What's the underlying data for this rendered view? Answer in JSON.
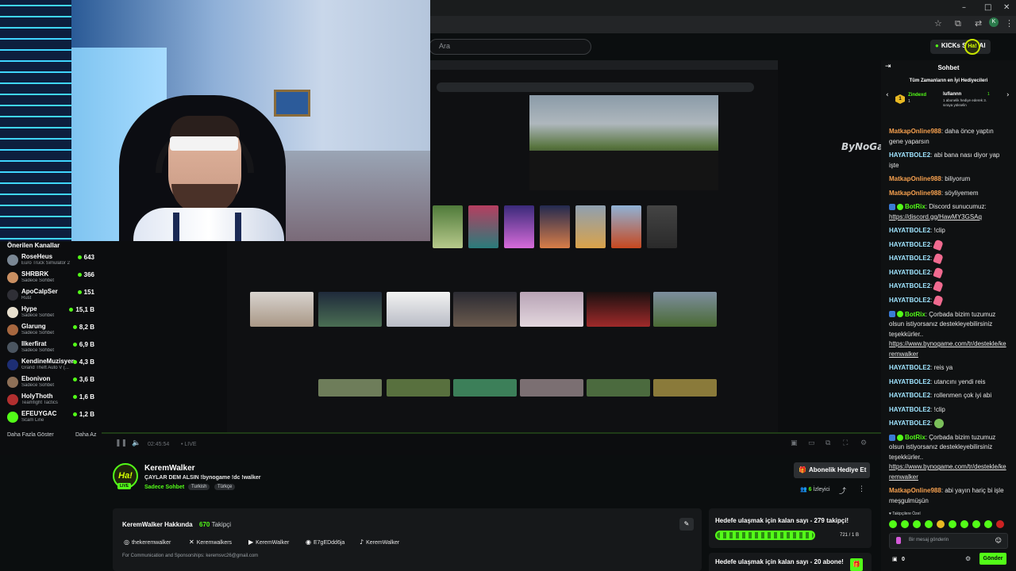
{
  "browser": {
    "window_controls": [
      "–",
      "□",
      "✕"
    ],
    "profile_initial": "K"
  },
  "header": {
    "search_placeholder": "Ara",
    "kicks_label": "KICKs Satın Al",
    "avatar_text": "Ha!"
  },
  "screen": {
    "watermark": "ByNoGame"
  },
  "sidebar": {
    "title": "Önerilen Kanallar",
    "items": [
      {
        "name": "RoseHeus",
        "category": "Euro Truck Simulator 2",
        "viewers": "643",
        "color": "#7a8794"
      },
      {
        "name": "SHRBRK",
        "category": "Sadece Sohbet",
        "viewers": "366",
        "color": "#c98f62"
      },
      {
        "name": "ApoCalpSer",
        "category": "Rust",
        "viewers": "151",
        "color": "#2f2f36"
      },
      {
        "name": "Hype",
        "category": "Sadece Sohbet",
        "viewers": "15,1 B",
        "color": "#e8e0cf"
      },
      {
        "name": "Glarung",
        "category": "Sadece Sohbet",
        "viewers": "8,2 B",
        "color": "#a7673f"
      },
      {
        "name": "Ilkerfirat",
        "category": "Sadece Sohbet",
        "viewers": "6,9 B",
        "color": "#4b5560"
      },
      {
        "name": "KendineMuzisyen",
        "category": "Grand Theft Auto V (...",
        "viewers": "4,3 B",
        "color": "#1d2e74"
      },
      {
        "name": "Ebonivon",
        "category": "Sadece Sohbet",
        "viewers": "3,6 B",
        "color": "#8e7057"
      },
      {
        "name": "HolyThoth",
        "category": "Teamfight Tactics",
        "viewers": "1,6 B",
        "color": "#b22f2f"
      },
      {
        "name": "EFEUYGAC",
        "category": "Scam Line",
        "viewers": "1,2 B",
        "color": "#53fc18"
      }
    ],
    "show_more": "Daha Fazla Göster",
    "show_less": "Daha Az"
  },
  "player": {
    "time": "02:45:54",
    "live": "• LIVE"
  },
  "channel": {
    "logo_text": "Ha!",
    "live_badge": "LIVE",
    "name": "KeremWalker",
    "title": "ÇAYLAR DEM ALSIN   !bynogame !dc !walker",
    "category": "Sadece Sohbet",
    "tags": [
      "Turkish",
      "Türkçe"
    ],
    "gift_button": "Abonelik Hediye Et",
    "viewers_count": "6",
    "viewers_label": "İzleyici"
  },
  "about": {
    "title": "KeremWalker Hakkında",
    "followers_count": "670",
    "followers_label": "Takipçi",
    "socials": [
      {
        "icon": "◎",
        "label": "thekeremwalker"
      },
      {
        "icon": "✕",
        "label": "Keremwalkers"
      },
      {
        "icon": "▶",
        "label": "KeremWalker"
      },
      {
        "icon": "◉",
        "label": "E7gEDdd6ja"
      },
      {
        "icon": "♪",
        "label": "KeremWalker"
      }
    ],
    "contact": "For Communication and Sponsorships: keremsvc26@gmail.com"
  },
  "goals": {
    "follower_goal_title": "Hedefe ulaşmak için kalan sayı - 279 takipçi!",
    "follower_goal_progress": "721 / 1 B",
    "follower_goal_fraction": 0.72,
    "sub_goal_title": "Hedefe ulaşmak için kalan sayı - 20 abone!"
  },
  "chat": {
    "title": "Sohbet",
    "gifters_title": "Tüm Zamanların en İyi Hediyecileri",
    "gifter1_name": "Zindexd",
    "gifter1_count": "1",
    "gifter2_name": "lufiannn",
    "gifter2_count": "1",
    "gifter2_sub": "1 abonelik hediye ederek 3. sıraya yükselin",
    "messages": [
      {
        "user": "MatkapOnline988",
        "color": "#f7a14f",
        "text": "daha önce yaptın gene yaparsın"
      },
      {
        "user": "HAYATBOLE2",
        "color": "#9fe4ff",
        "text": "abi bana nası diyor yap işte"
      },
      {
        "user": "MatkapOnline988",
        "color": "#f7a14f",
        "text": "biliyorum"
      },
      {
        "user": "MatkapOnline988",
        "color": "#f7a14f",
        "text": "söyliyemem"
      },
      {
        "user": "BotRix",
        "color": "#53fc18",
        "text": "Discord sunucumuz:",
        "link": "https://discord.gg/HawMY3GSAq",
        "bot": true
      },
      {
        "user": "HAYATBOLE2",
        "color": "#9fe4ff",
        "text": "!clip"
      },
      {
        "user": "HAYATBOLE2",
        "color": "#9fe4ff",
        "text": "",
        "emote": true
      },
      {
        "user": "HAYATBOLE2",
        "color": "#9fe4ff",
        "text": "",
        "emote": true
      },
      {
        "user": "HAYATBOLE2",
        "color": "#9fe4ff",
        "text": "",
        "emote": true
      },
      {
        "user": "HAYATBOLE2",
        "color": "#9fe4ff",
        "text": "",
        "emote": true
      },
      {
        "user": "HAYATBOLE2",
        "color": "#9fe4ff",
        "text": "",
        "emote": true
      },
      {
        "user": "BotRix",
        "color": "#53fc18",
        "text": "Çorbada bizim tuzumuz olsun istiyorsanız destekleyebilirsiniz teşekkürler..",
        "link": "https://www.bynogame.com/tr/destekle/keremwalker",
        "bot": true
      },
      {
        "user": "HAYATBOLE2",
        "color": "#9fe4ff",
        "text": "reis ya"
      },
      {
        "user": "HAYATBOLE2",
        "color": "#9fe4ff",
        "text": "utancını yendi reis"
      },
      {
        "user": "HAYATBOLE2",
        "color": "#9fe4ff",
        "text": "rollenmen çok iyi abi"
      },
      {
        "user": "HAYATBOLE2",
        "color": "#9fe4ff",
        "text": "!clip"
      },
      {
        "user": "HAYATBOLE2",
        "color": "#9fe4ff",
        "text": "",
        "emote": true,
        "green": true
      },
      {
        "user": "BotRix",
        "color": "#53fc18",
        "text": "Çorbada bizim tuzumuz olsun istiyorsanız destekleyebilirsiniz teşekkürler..",
        "link": "https://www.bynogame.com/tr/destekle/keremwalker",
        "bot": true
      },
      {
        "user": "MatkapOnline988",
        "color": "#f7a14f",
        "text": "abi yayın hariç bi işle meşgulmüşün"
      }
    ],
    "followers_only": "Takipçilere Özel",
    "input_placeholder": "Bir mesaj gönderin",
    "points": "0",
    "send": "Gönder"
  }
}
